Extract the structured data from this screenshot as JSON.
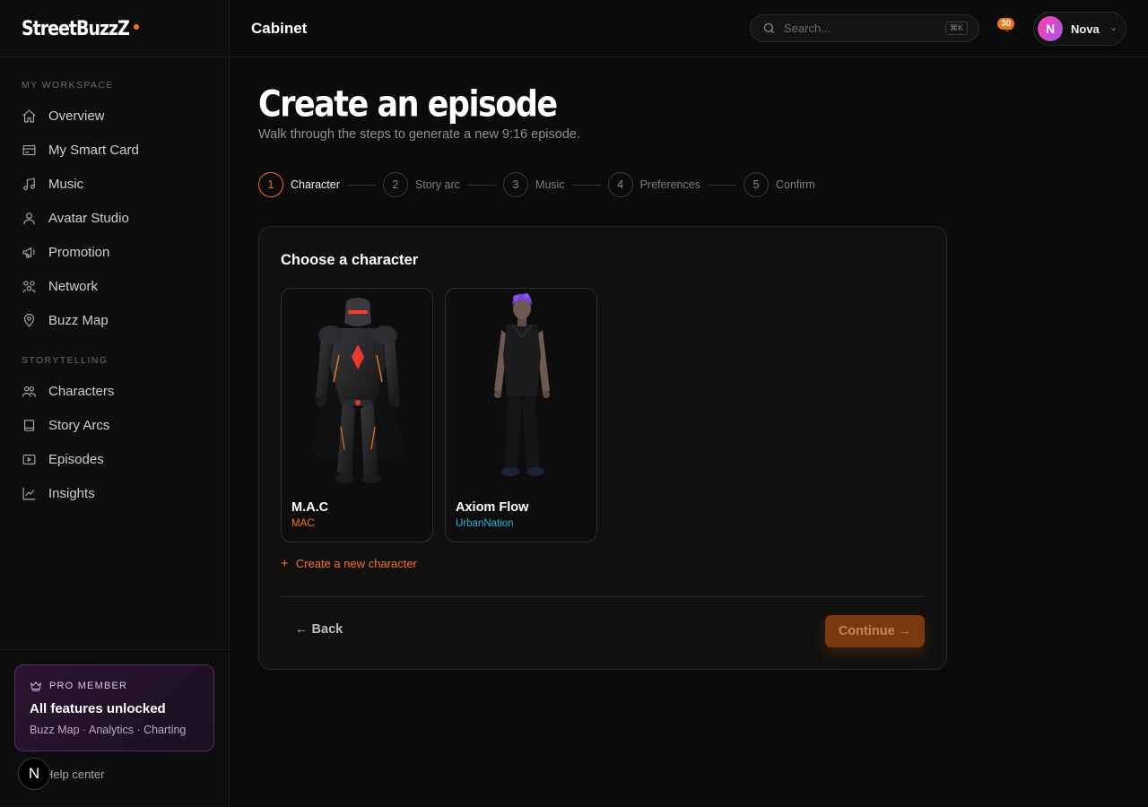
{
  "brand": {
    "name": "StreetBuzzZ",
    "accent": "#f97316"
  },
  "sidebar": {
    "sections": [
      {
        "label": "MY WORKSPACE",
        "items": [
          {
            "label": "Overview",
            "icon": "home-icon"
          },
          {
            "label": "My Smart Card",
            "icon": "card-icon"
          },
          {
            "label": "Music",
            "icon": "music-icon"
          },
          {
            "label": "Avatar Studio",
            "icon": "user-icon"
          },
          {
            "label": "Promotion",
            "icon": "megaphone-icon"
          },
          {
            "label": "Network",
            "icon": "network-icon"
          },
          {
            "label": "Buzz Map",
            "icon": "map-pin-icon"
          }
        ]
      },
      {
        "label": "STORYTELLING",
        "items": [
          {
            "label": "Characters",
            "icon": "characters-icon"
          },
          {
            "label": "Story Arcs",
            "icon": "book-icon"
          },
          {
            "label": "Episodes",
            "icon": "video-icon"
          },
          {
            "label": "Insights",
            "icon": "chart-icon"
          }
        ]
      }
    ],
    "pro": {
      "label": "PRO MEMBER",
      "title": "All features unlocked",
      "subtitle": "Buzz Map · Analytics · Charting"
    },
    "help": {
      "badge": "N",
      "label": "Help center"
    }
  },
  "header": {
    "title": "Cabinet",
    "search_placeholder": "Search...",
    "search_shortcut": "⌘K",
    "notifications": "30",
    "user": {
      "initial": "N",
      "name": "Nova"
    }
  },
  "main": {
    "title": "Create an episode",
    "subtitle": "Walk through the steps to generate a new 9:16 episode.",
    "steps": [
      {
        "num": "1",
        "label": "Character",
        "active": true
      },
      {
        "num": "2",
        "label": "Story arc",
        "active": false
      },
      {
        "num": "3",
        "label": "Music",
        "active": false
      },
      {
        "num": "4",
        "label": "Preferences",
        "active": false
      },
      {
        "num": "5",
        "label": "Confirm",
        "active": false
      }
    ],
    "card": {
      "title": "Choose a character",
      "characters": [
        {
          "name": "M.A.C",
          "handle": "MAC",
          "handle_color": "#f97316"
        },
        {
          "name": "Axiom Flow",
          "handle": "UrbanNation",
          "handle_color": "#22b8d6"
        }
      ],
      "create_label": "Create a new character",
      "back_label": "← Back",
      "continue_label": "Continue →"
    }
  }
}
